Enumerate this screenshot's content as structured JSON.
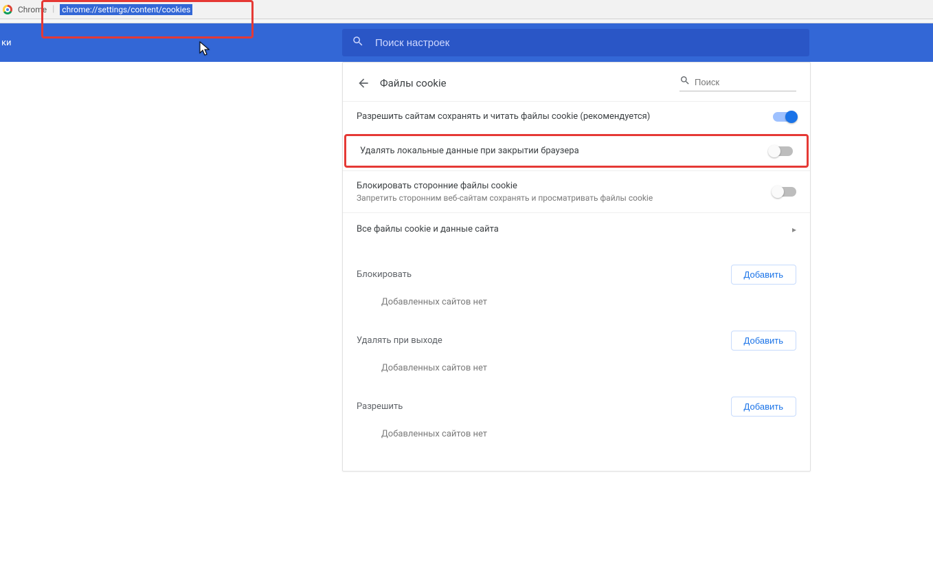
{
  "tab": {
    "app": "Chrome",
    "url": "chrome://settings/content/cookies"
  },
  "sidebar_fragment": "ки",
  "header": {
    "search_placeholder": "Поиск настроек"
  },
  "card": {
    "title": "Файлы cookie",
    "search_placeholder": "Поиск",
    "rows": {
      "allow": {
        "label": "Разрешить сайтам сохранять и читать файлы cookie (рекомендуется)",
        "on": true
      },
      "clear_on_exit": {
        "label": "Удалять локальные данные при закрытии браузера",
        "on": false
      },
      "block_third": {
        "label": "Блокировать сторонние файлы cookie",
        "sub": "Запретить сторонним веб-сайтам сохранять и просматривать файлы cookie",
        "on": false
      }
    },
    "all_data": "Все файлы cookie и данные сайта",
    "sections": {
      "block": {
        "title": "Блокировать",
        "add": "Добавить",
        "empty": "Добавленных сайтов нет"
      },
      "onexit": {
        "title": "Удалять при выходе",
        "add": "Добавить",
        "empty": "Добавленных сайтов нет"
      },
      "allow": {
        "title": "Разрешить",
        "add": "Добавить",
        "empty": "Добавленных сайтов нет"
      }
    }
  }
}
